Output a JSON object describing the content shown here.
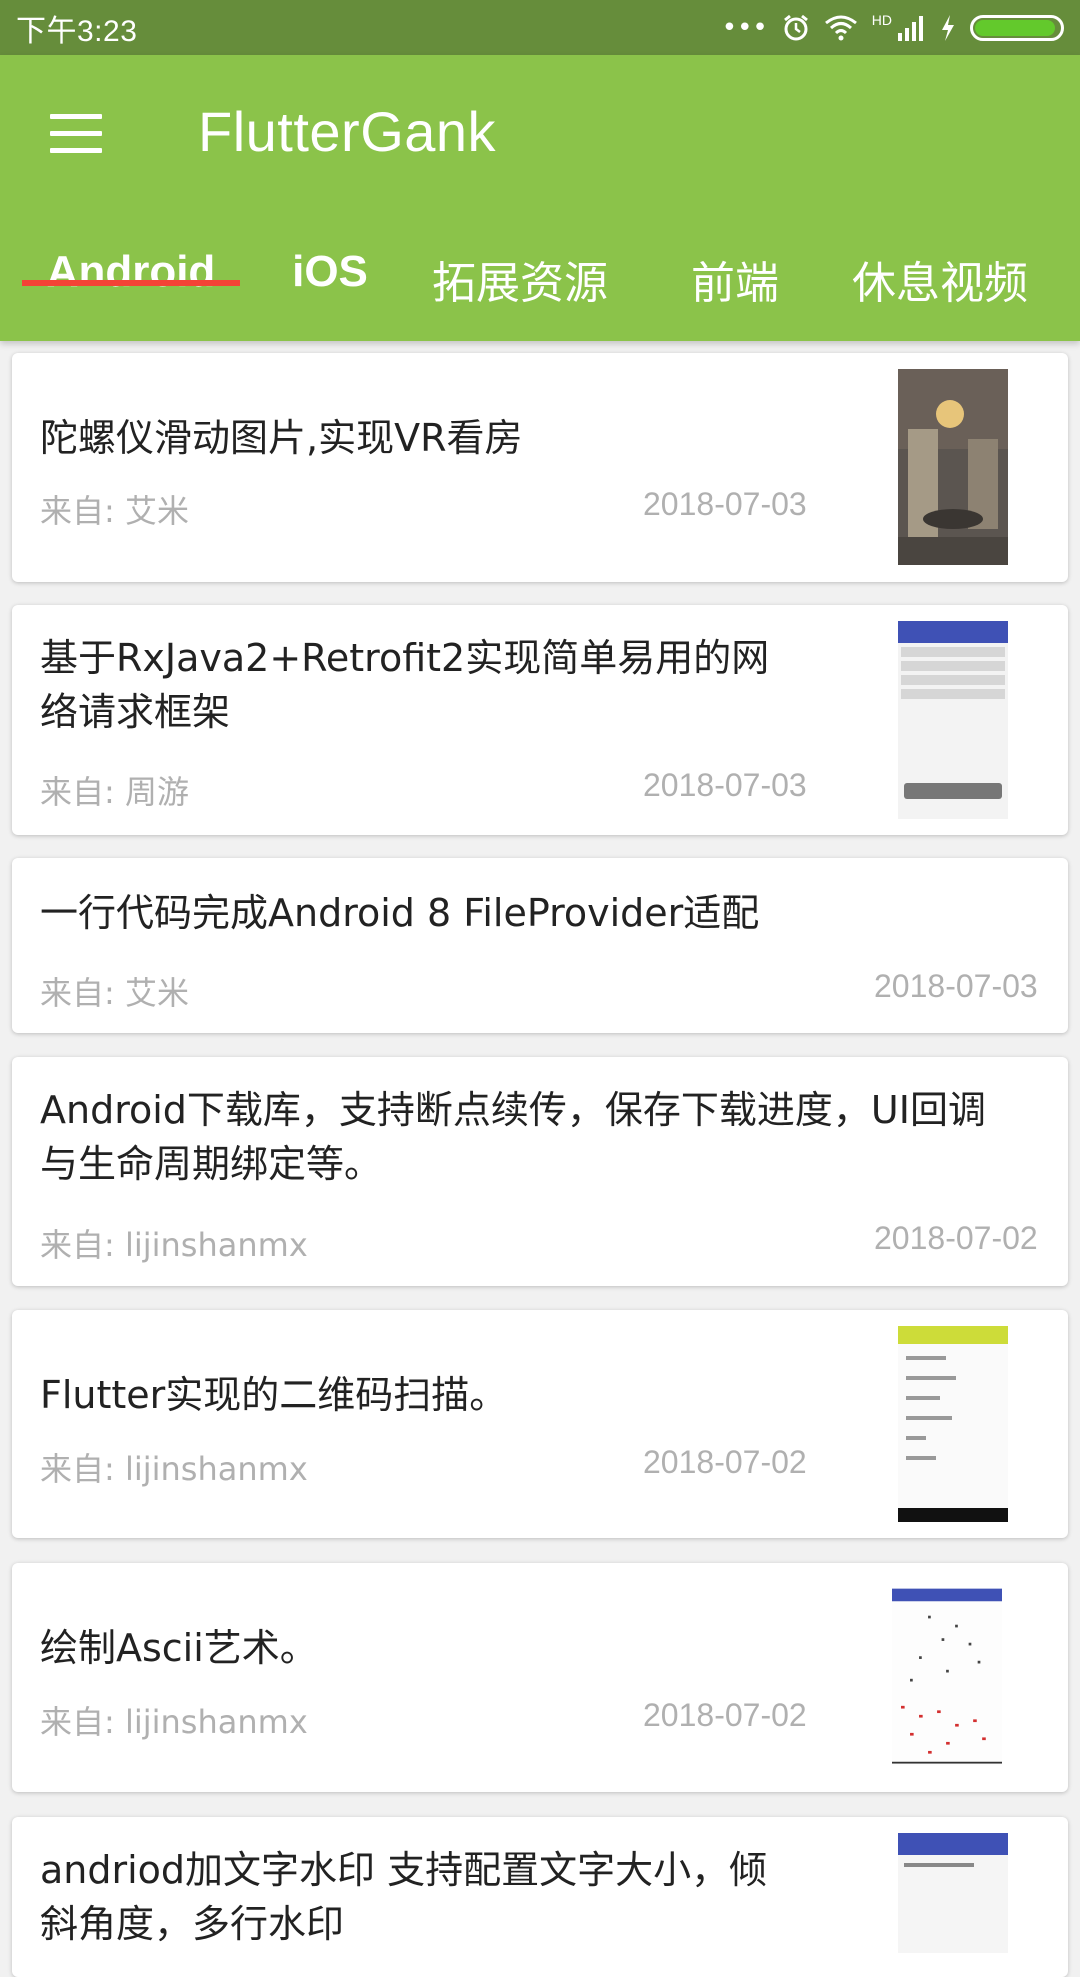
{
  "status": {
    "time": "下午3:23",
    "icons": [
      "more-dots-icon",
      "alarm-icon",
      "wifi-icon",
      "hd-signal-icon",
      "charging-icon",
      "battery-icon"
    ],
    "battery_level": 0.95
  },
  "app_bar": {
    "title": "FlutterGank",
    "color": "#8bc34a",
    "status_color": "#668d3b"
  },
  "tabs": [
    {
      "label": "Android",
      "selected": true
    },
    {
      "label": "iOS",
      "selected": false
    },
    {
      "label": "拓展资源",
      "selected": false
    },
    {
      "label": "前端",
      "selected": false
    },
    {
      "label": "休息视频",
      "selected": false
    }
  ],
  "indicator_color": "#f44336",
  "items": [
    {
      "title": "陀螺仪滑动图片,实现VR看房",
      "source": "来自: 艾米",
      "date": "2018-07-03",
      "thumb": "room-photo"
    },
    {
      "title": "基于RxJava2+Retrofit2实现简单易用的网络请求框架",
      "title_line1": "基于RxJava2+Retrofit2实现简单易用的网",
      "title_line2": "络请求框架",
      "source": "来自: 周游",
      "date": "2018-07-03",
      "thumb": "rxeasyhttp-screenshot"
    },
    {
      "title": "一行代码完成Android 8 FileProvider适配",
      "source": "来自: 艾米",
      "date": "2018-07-03"
    },
    {
      "title": "Android下载库，支持断点续传，保存下载进度，UI回调与生命周期绑定等。",
      "title_line1": "Android下载库，支持断点续传，保存下载进度，UI回调",
      "title_line2": "与生命周期绑定等。",
      "source": "来自: lijinshanmx",
      "date": "2018-07-02"
    },
    {
      "title": "Flutter实现的二维码扫描。",
      "source": "来自: lijinshanmx",
      "date": "2018-07-02",
      "thumb": "barcode-app-screenshot"
    },
    {
      "title": "绘制Ascii艺术。",
      "source": "来自: lijinshanmx",
      "date": "2018-07-02",
      "thumb": "ascii-art-screenshot"
    },
    {
      "title_line1": "andriod加文字水印 支持配置文字大小，倾",
      "title_line2": "斜角度，多行水印",
      "thumb": "watermark-screenshot"
    }
  ]
}
